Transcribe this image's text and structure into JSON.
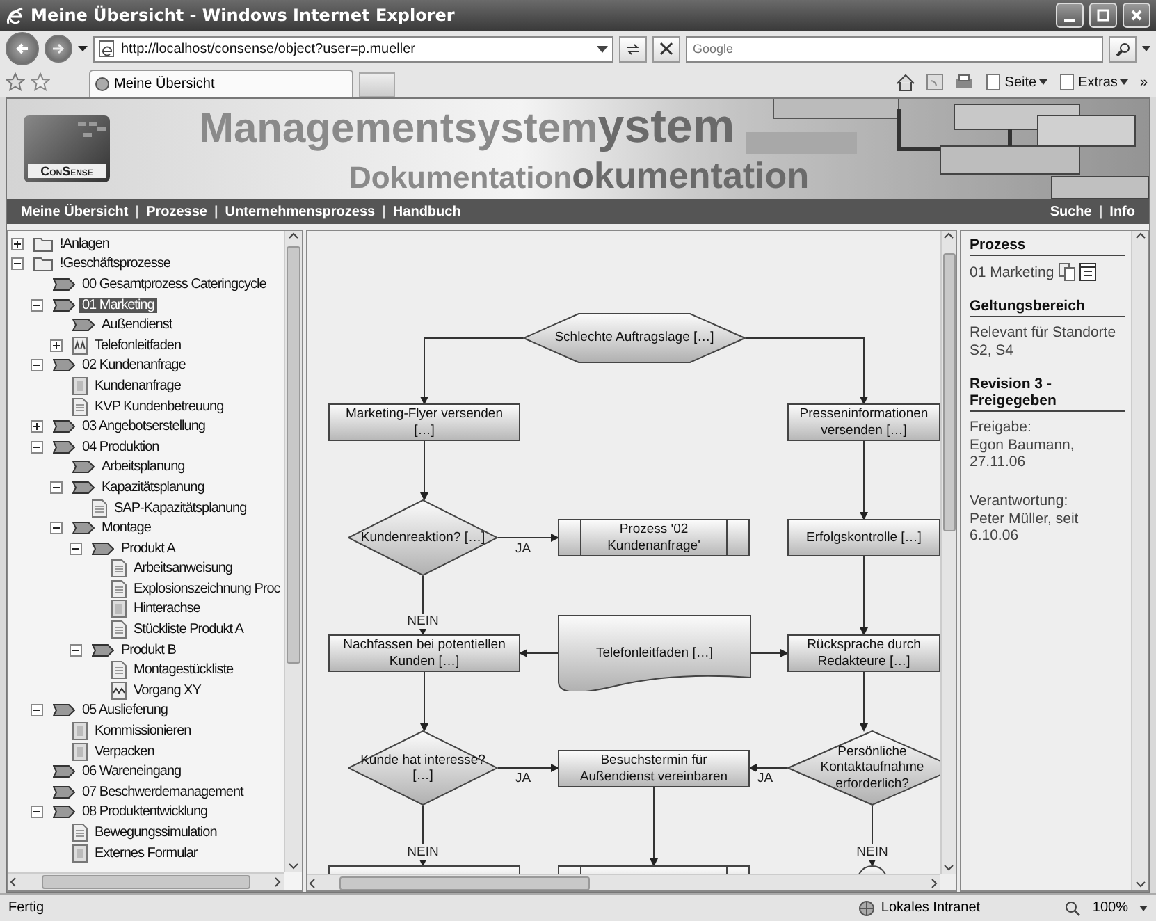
{
  "window": {
    "title": "Meine Übersicht - Windows Internet Explorer"
  },
  "address_bar": {
    "url": "http://localhost/consense/object?user=p.mueller"
  },
  "search": {
    "placeholder": "Google"
  },
  "tabs": [
    {
      "label": "Meine Übersicht",
      "selected": true
    }
  ],
  "toolbar": {
    "menus": [
      "Seite",
      "Extras"
    ],
    "overflow": "»"
  },
  "banner": {
    "logo": "ConSense",
    "title": "Managementsystem",
    "title_echo": "ystem",
    "subtitle": "Dokumentation",
    "subtitle_echo": "okumentation"
  },
  "nav": {
    "separator": "|",
    "left": [
      "Meine Übersicht",
      "Prozesse",
      "Unternehmensprozess",
      "Handbuch"
    ],
    "right": [
      "Suche",
      "Info"
    ]
  },
  "tree": [
    {
      "label": "!Anlagen",
      "kind": "folder",
      "expanded": false,
      "selected": false
    },
    {
      "label": "!Geschäftsprozesse",
      "kind": "folder",
      "expanded": true,
      "selected": false,
      "children": [
        {
          "label": "00 Gesamtprozess Cateringcycle",
          "kind": "process",
          "selected": false
        },
        {
          "label": "01 Marketing",
          "kind": "process",
          "expanded": true,
          "selected": true,
          "children": [
            {
              "label": "Außendienst",
              "kind": "process",
              "selected": false
            },
            {
              "label": "Telefonleitfaden",
              "kind": "text",
              "expanded": false,
              "selected": false
            }
          ]
        },
        {
          "label": "02 Kundenanfrage",
          "kind": "process",
          "expanded": true,
          "selected": false,
          "children": [
            {
              "label": "Kundenanfrage",
              "kind": "form",
              "selected": false
            },
            {
              "label": "KVP Kundenbetreuung",
              "kind": "document",
              "selected": false
            }
          ]
        },
        {
          "label": "03 Angebotserstellung",
          "kind": "process",
          "expanded": false,
          "selected": false
        },
        {
          "label": "04 Produktion",
          "kind": "process",
          "expanded": true,
          "selected": false,
          "children": [
            {
              "label": "Arbeitsplanung",
              "kind": "process",
              "selected": false
            },
            {
              "label": "Kapazitätsplanung",
              "kind": "process",
              "expanded": true,
              "selected": false,
              "children": [
                {
                  "label": "SAP-Kapazitätsplanung",
                  "kind": "document",
                  "selected": false
                }
              ]
            },
            {
              "label": "Montage",
              "kind": "process",
              "expanded": true,
              "selected": false,
              "children": [
                {
                  "label": "Produkt A",
                  "kind": "process",
                  "expanded": true,
                  "selected": false,
                  "children": [
                    {
                      "label": "Arbeitsanweisung",
                      "kind": "document",
                      "selected": false
                    },
                    {
                      "label": "Explosionszeichnung Proc",
                      "kind": "document",
                      "selected": false
                    },
                    {
                      "label": "Hinterachse",
                      "kind": "form",
                      "selected": false
                    },
                    {
                      "label": "Stückliste Produkt A",
                      "kind": "document",
                      "selected": false
                    }
                  ]
                },
                {
                  "label": "Produkt B",
                  "kind": "process",
                  "expanded": true,
                  "selected": false,
                  "children": [
                    {
                      "label": "Montagestückliste",
                      "kind": "document",
                      "selected": false
                    },
                    {
                      "label": "Vorgang XY",
                      "kind": "chart",
                      "selected": false
                    }
                  ]
                }
              ]
            }
          ]
        },
        {
          "label": "05 Auslieferung",
          "kind": "process",
          "expanded": true,
          "selected": false,
          "children": [
            {
              "label": "Kommissionieren",
              "kind": "form",
              "selected": false
            },
            {
              "label": "Verpacken",
              "kind": "form",
              "selected": false
            }
          ]
        },
        {
          "label": "06 Wareneingang",
          "kind": "process",
          "selected": false
        },
        {
          "label": "07 Beschwerdemanagement",
          "kind": "process",
          "selected": false
        },
        {
          "label": "08 Produktentwicklung",
          "kind": "process",
          "expanded": true,
          "selected": false,
          "children": [
            {
              "label": "Bewegungssimulation",
              "kind": "document",
              "selected": false
            },
            {
              "label": "Externes Formular",
              "kind": "form",
              "selected": false
            }
          ]
        }
      ]
    }
  ],
  "diagram": {
    "nodes": [
      {
        "kind": "hexagon",
        "text": "Schlechte Auftragslage […]"
      },
      {
        "kind": "process",
        "text": "Marketing-Flyer versenden […]"
      },
      {
        "kind": "process",
        "text": "Presseninformationen versenden […]"
      },
      {
        "kind": "decision",
        "text": "Kundenreaktion? […]"
      },
      {
        "kind": "subprocess",
        "text": "Prozess '02 Kundenanfrage'"
      },
      {
        "kind": "process",
        "text": "Erfolgskontrolle […]"
      },
      {
        "kind": "process",
        "text": "Nachfassen bei potentiellen Kunden […]"
      },
      {
        "kind": "document",
        "text": "Telefonleitfaden […]"
      },
      {
        "kind": "process",
        "text": "Rücksprache durch Redakteure […]"
      },
      {
        "kind": "decision",
        "text": "Kunde hat interesse? […]"
      },
      {
        "kind": "process",
        "text": "Besuchstermin für Außendienst vereinbaren"
      },
      {
        "kind": "decision",
        "text": "Persönliche Kontaktaufnahme erforderlich?"
      },
      {
        "kind": "process"
      },
      {
        "kind": "subprocess"
      },
      {
        "kind": "circle"
      }
    ],
    "connector_labels": [
      "JA",
      "NEIN",
      "JA",
      "JA",
      "NEIN",
      "NEIN"
    ]
  },
  "details": {
    "sections": [
      {
        "heading": "Prozess",
        "paragraphs": [
          [
            "01 Marketing"
          ]
        ]
      },
      {
        "heading": "Geltungsbereich",
        "paragraphs": [
          [
            "Relevant für Standorte",
            "S2, S4"
          ]
        ]
      },
      {
        "heading": "Revision 3 - Freigegeben",
        "paragraphs": [
          [
            "Freigabe:",
            "Egon Baumann, 27.11.06"
          ],
          [
            "Verantwortung:",
            "Peter Müller, seit 6.10.06"
          ]
        ]
      }
    ]
  },
  "status_bar": {
    "text": "Fertig",
    "zone": "Lokales Intranet",
    "zoom": "100%"
  }
}
